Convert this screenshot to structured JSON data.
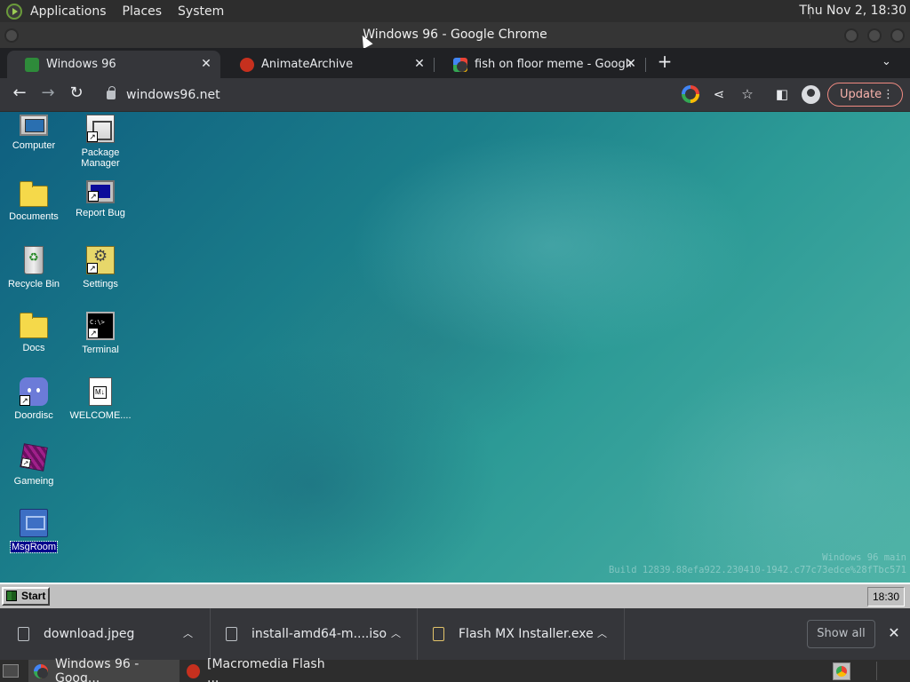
{
  "top_panel": {
    "menus": [
      "Applications",
      "Places",
      "System"
    ],
    "clock": "Thu Nov  2, 18:30"
  },
  "window": {
    "title": "Windows 96 - Google Chrome"
  },
  "tabs": [
    {
      "label": "Windows 96",
      "favicon_color": "#2e8b3a",
      "active": true
    },
    {
      "label": "AnimateArchive",
      "favicon_color": "#c6301e",
      "active": false
    },
    {
      "label": "fish on floor meme - Google S",
      "favicon_color": "#4285f4",
      "active": false
    }
  ],
  "toolbar": {
    "url": "windows96.net",
    "update_label": "Update"
  },
  "desktop": {
    "icons_col1": [
      {
        "label": "Computer",
        "icon": "computer-icon"
      },
      {
        "label": "Documents",
        "icon": "folder-icon"
      },
      {
        "label": "Recycle Bin",
        "icon": "recycle-bin-icon"
      },
      {
        "label": "Docs",
        "icon": "folder-icon"
      },
      {
        "label": "Doordisc",
        "icon": "discord-icon"
      },
      {
        "label": "Gameing",
        "icon": "cube-icon"
      },
      {
        "label": "MsgRoom",
        "icon": "msgroom-icon",
        "selected": true
      }
    ],
    "icons_col2": [
      {
        "label": "Package",
        "label2": "Manager",
        "icon": "package-icon"
      },
      {
        "label": "Report Bug",
        "icon": "report-bug-icon"
      },
      {
        "label": "Settings",
        "icon": "settings-icon"
      },
      {
        "label": "Terminal",
        "icon": "terminal-icon"
      },
      {
        "label": "WELCOME....",
        "icon": "markdown-file-icon"
      }
    ],
    "watermark_line1": "Windows 96 main",
    "watermark_line2": "Build 12839.88efa922.230410-1942.c77c73edce%28fTbc571"
  },
  "w96_taskbar": {
    "start_label": "Start",
    "tray_time": "18:30"
  },
  "downloads": {
    "items": [
      {
        "name": "download.jpeg",
        "icon": "image-file-icon"
      },
      {
        "name": "install-amd64-m....iso",
        "icon": "disc-file-icon"
      },
      {
        "name": "Flash MX Installer.exe",
        "icon": "exe-file-icon"
      }
    ],
    "show_all_label": "Show all"
  },
  "bottom_panel": {
    "tasks": [
      {
        "label": "Windows 96 - Goog...",
        "icon_color": "#4285f4",
        "active": true
      },
      {
        "label": "[Macromedia Flash ...",
        "icon_color": "#c6301e",
        "active": false
      }
    ]
  },
  "colors": {
    "chrome_dark": "#35363a",
    "tab_strip": "#202124",
    "desktop_teal": "#1b7e8a",
    "win96_gray": "#c0c0c0",
    "update_accent": "#f28b82"
  }
}
